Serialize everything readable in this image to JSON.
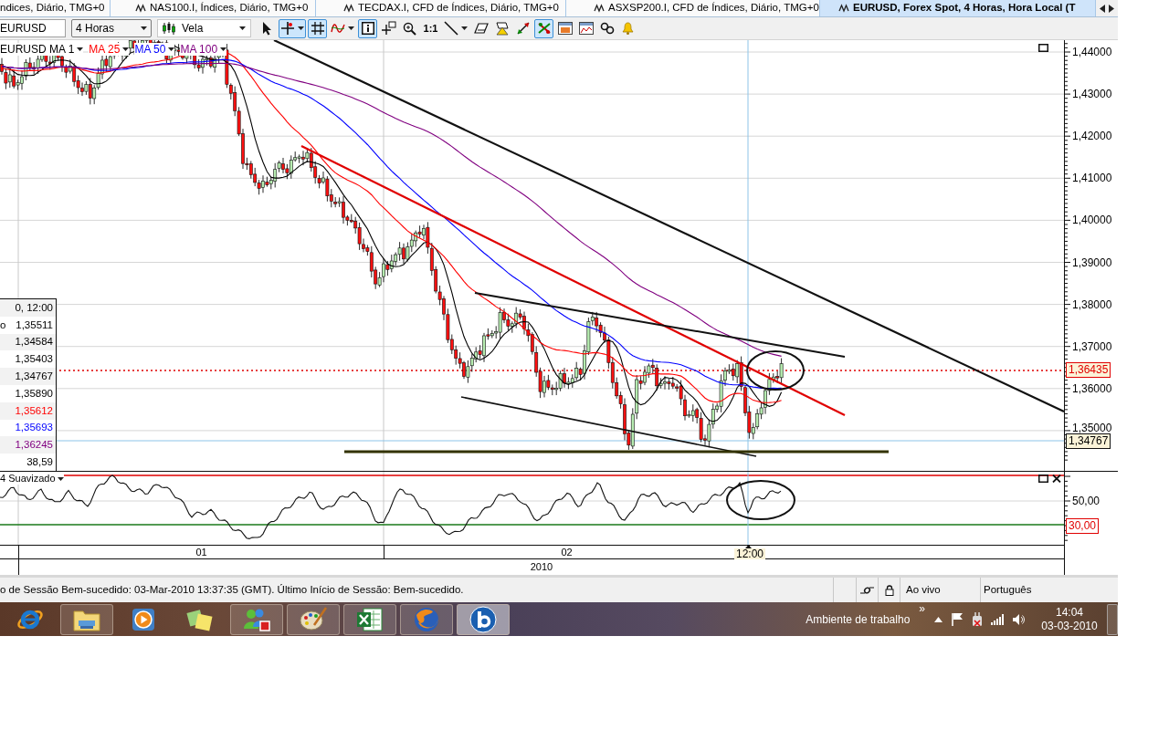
{
  "tabs": [
    {
      "label": "ndices, Diário, TMG+0",
      "selected": false
    },
    {
      "label": "NAS100.I, Índices, Diário, TMG+0",
      "selected": false
    },
    {
      "label": "TECDAX.I, CFD de Índices, Diário, TMG+0",
      "selected": false
    },
    {
      "label": "ASXSP200.I, CFD de Índices, Diário, TMG+0",
      "selected": false
    },
    {
      "label": "EURUSD, Forex Spot, 4 Horas, Hora Local (T",
      "selected": true
    }
  ],
  "toolbar": {
    "symbol": "EURUSD",
    "period": "4 Horas",
    "chart_type": "Vela",
    "tools": [
      {
        "kind": "pointer",
        "selected": false,
        "menu": false
      },
      {
        "kind": "crosshair",
        "selected": true,
        "menu": true
      },
      {
        "kind": "grid",
        "selected": true,
        "menu": false
      },
      {
        "kind": "indicator",
        "selected": false,
        "menu": true
      },
      {
        "kind": "info",
        "selected": true,
        "menu": false
      },
      {
        "kind": "marker",
        "selected": false,
        "menu": false
      },
      {
        "kind": "zoom",
        "selected": false,
        "menu": false
      },
      {
        "kind": "actual_size",
        "label": "1:1",
        "selected": false,
        "menu": false
      },
      {
        "kind": "line",
        "selected": false,
        "menu": true
      },
      {
        "kind": "eraser",
        "selected": false,
        "menu": false
      },
      {
        "kind": "alert",
        "selected": false,
        "menu": false
      },
      {
        "kind": "arrow_line",
        "selected": false,
        "menu": false
      },
      {
        "kind": "trades",
        "selected": true,
        "menu": false
      },
      {
        "kind": "template",
        "selected": false,
        "menu": false
      },
      {
        "kind": "chart_window",
        "selected": false,
        "menu": false
      },
      {
        "kind": "link",
        "selected": false,
        "menu": false
      },
      {
        "kind": "bell",
        "selected": false,
        "menu": false
      }
    ]
  },
  "chart": {
    "legend": {
      "symbol": "EURUSD",
      "items": [
        {
          "label": "MA 1",
          "color": "#000000"
        },
        {
          "label": "MA 25",
          "color": "#ff0000"
        },
        {
          "label": "MA 50",
          "color": "#0000ff"
        },
        {
          "label": "MA 100",
          "color": "#800080"
        }
      ]
    },
    "price_axis": [
      "1,44000",
      "1,43000",
      "1,42000",
      "1,41000",
      "1,40000",
      "1,39000",
      "1,38000",
      "1,37000",
      "1,36000",
      "1,35000"
    ],
    "last_price": "1,36435",
    "cursor_price": "1,34767",
    "data_window": [
      {
        "value": "0, 12:00",
        "color": "#000000"
      },
      {
        "label": "o",
        "value": "1,35511",
        "color": "#000000"
      },
      {
        "value": "1,34584",
        "color": "#000000"
      },
      {
        "value": "1,35403",
        "color": "#000000"
      },
      {
        "value": "1,34767",
        "color": "#000000"
      },
      {
        "value": "1,35890",
        "color": "#000000"
      },
      {
        "value": "1,35612",
        "color": "#ff0000"
      },
      {
        "value": "1,35693",
        "color": "#0000ff"
      },
      {
        "value": "1,36245",
        "color": "#800080"
      },
      {
        "value": "38,59",
        "color": "#000000"
      }
    ]
  },
  "indicator": {
    "label": "4 Suavizado",
    "axis_label": "50,00",
    "lower_level": "30,00"
  },
  "time_axis": {
    "months": [
      "01",
      "02"
    ],
    "cursor": "12:00",
    "year": "2010"
  },
  "status_bar": {
    "message": "o de Sessão Bem-sucedido: 03-Mar-2010 13:37:35 (GMT). Último Início de Sessão: Bem-sucedido.",
    "connection": "Ao vivo",
    "language": "Português"
  },
  "taskbar": {
    "apps": [
      {
        "kind": "ie",
        "running": false,
        "selected": false
      },
      {
        "kind": "explorer",
        "running": true,
        "selected": false
      },
      {
        "kind": "media",
        "running": false,
        "selected": false
      },
      {
        "kind": "notes",
        "running": false,
        "selected": false
      },
      {
        "kind": "messenger",
        "running": true,
        "selected": false
      },
      {
        "kind": "paint",
        "running": true,
        "selected": false
      },
      {
        "kind": "excel",
        "running": true,
        "selected": false
      },
      {
        "kind": "firefox",
        "running": true,
        "selected": false
      },
      {
        "kind": "bapp",
        "running": true,
        "selected": true
      }
    ],
    "desktop_toolbar": "Ambiente de trabalho",
    "overflow": "»",
    "time": "14:04",
    "date": "03-03-2010"
  }
}
